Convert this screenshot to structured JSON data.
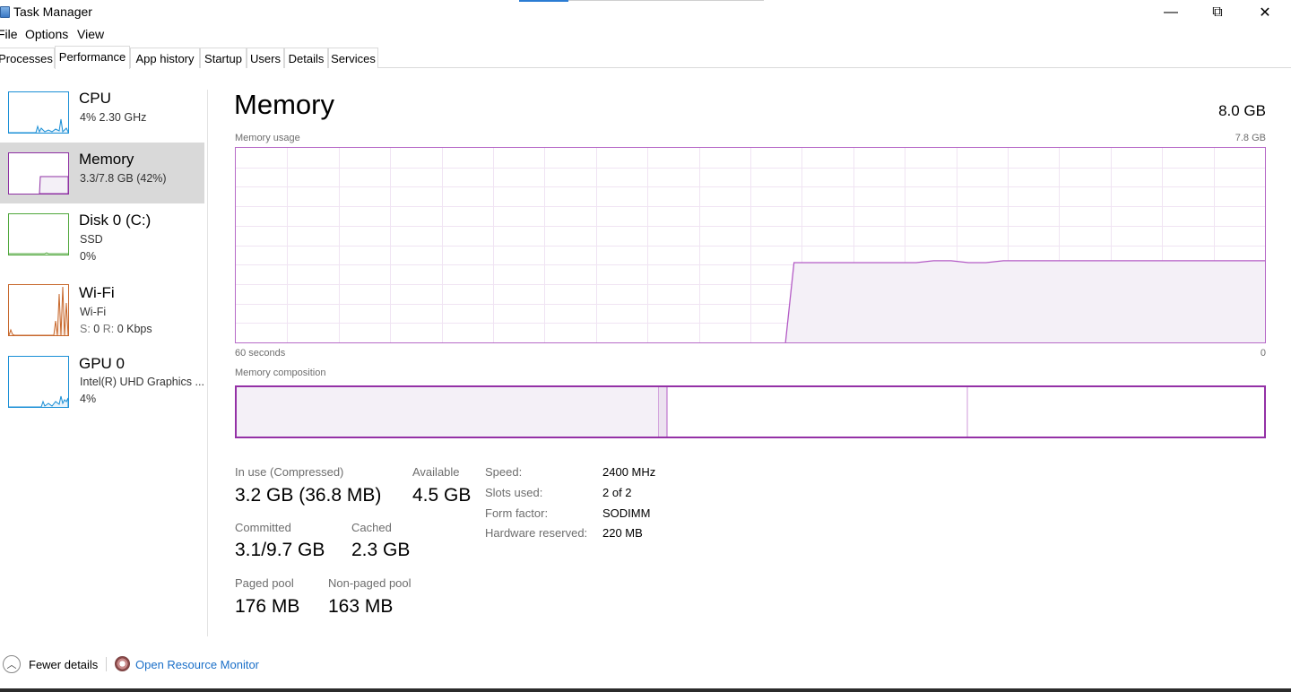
{
  "window": {
    "title": "Task Manager",
    "controls": {
      "minimize": "—",
      "maximize": "⧉",
      "close": "✕"
    }
  },
  "menu": [
    "File",
    "Options",
    "View"
  ],
  "tabs": [
    "Processes",
    "Performance",
    "App history",
    "Startup",
    "Users",
    "Details",
    "Services"
  ],
  "active_tab": "Performance",
  "sidebar": {
    "items": [
      {
        "title": "CPU",
        "line1": "4% 2.30 GHz",
        "line2": "",
        "color": "#1a8fd6"
      },
      {
        "title": "Memory",
        "line1": "3.3/7.8 GB (42%)",
        "line2": "",
        "color": "#8e2fa3",
        "selected": true,
        "usage_fraction": 0.42
      },
      {
        "title": "Disk 0 (C:)",
        "line1": "SSD",
        "line2": "0%",
        "color": "#4fa73b"
      },
      {
        "title": "Wi-Fi",
        "line1": "Wi-Fi",
        "line2_s_key": "S:",
        "line2_s_val": "0",
        "line2_r_key": "R:",
        "line2_r_val": "0 Kbps",
        "color": "#c7672b"
      },
      {
        "title": "GPU 0",
        "line1": "Intel(R) UHD Graphics ...",
        "line2": "4%",
        "color": "#1a8fd6"
      }
    ]
  },
  "main": {
    "title": "Memory",
    "total": "8.0 GB",
    "usage_label": "Memory usage",
    "usage_max": "7.8 GB",
    "time_left": "60 seconds",
    "time_right": "0",
    "composition_label": "Memory composition",
    "usage_series_fraction": [
      0,
      0,
      0,
      0,
      0,
      0,
      0,
      0,
      0,
      0,
      0,
      0,
      0,
      0,
      0,
      0,
      0,
      0,
      0,
      0,
      0,
      0,
      0,
      0,
      0,
      0,
      0,
      0,
      0,
      0,
      0,
      0,
      0.41,
      0.41,
      0.41,
      0.41,
      0.41,
      0.41,
      0.41,
      0.41,
      0.42,
      0.42,
      0.41,
      0.41,
      0.42,
      0.42,
      0.42,
      0.42,
      0.42,
      0.42,
      0.42,
      0.42,
      0.42,
      0.42,
      0.42,
      0.42,
      0.42,
      0.42,
      0.42,
      0.42
    ],
    "stats": {
      "in_use_label": "In use (Compressed)",
      "in_use_value": "3.2 GB (36.8 MB)",
      "available_label": "Available",
      "available_value": "4.5 GB",
      "committed_label": "Committed",
      "committed_value": "3.1/9.7 GB",
      "cached_label": "Cached",
      "cached_value": "2.3 GB",
      "paged_label": "Paged pool",
      "paged_value": "176 MB",
      "nonpaged_label": "Non-paged pool",
      "nonpaged_value": "163 MB"
    },
    "details": [
      {
        "key": "Speed:",
        "value": "2400 MHz"
      },
      {
        "key": "Slots used:",
        "value": "2 of 2"
      },
      {
        "key": "Form factor:",
        "value": "SODIMM"
      },
      {
        "key": "Hardware reserved:",
        "value": "220 MB"
      }
    ]
  },
  "footer": {
    "fewer_details": "Fewer details",
    "resource_monitor": "Open Resource Monitor"
  },
  "colors": {
    "memory_accent": "#8e2fa3",
    "memory_fill": "#f4f0f7",
    "link": "#1a6fc8"
  }
}
